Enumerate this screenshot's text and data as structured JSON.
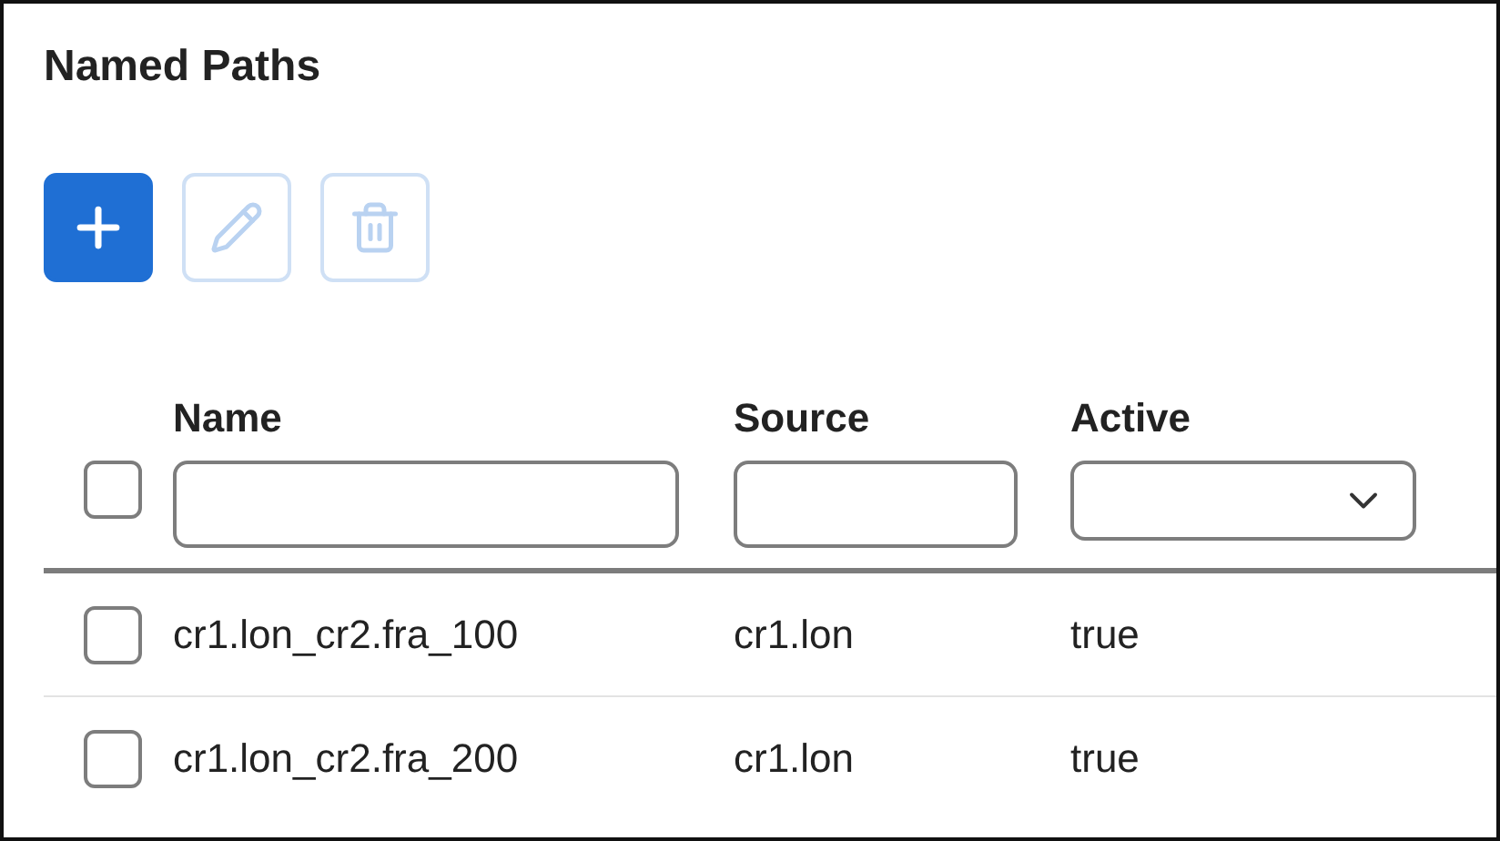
{
  "panel": {
    "title": "Named Paths"
  },
  "toolbar": [
    {
      "kind": "add",
      "disabled": false
    },
    {
      "kind": "edit",
      "disabled": true
    },
    {
      "kind": "delete",
      "disabled": true
    }
  ],
  "table": {
    "select_all": {
      "checked": false
    },
    "columns": [
      {
        "label": "Name",
        "kind": "text"
      },
      {
        "label": "Source",
        "kind": "text"
      },
      {
        "label": "Active",
        "kind": "select"
      }
    ],
    "rows": [
      {
        "checked": false,
        "cells": [
          "cr1.lon_cr2.fra_100",
          "cr1.lon",
          "true"
        ]
      },
      {
        "checked": false,
        "cells": [
          "cr1.lon_cr2.fra_200",
          "cr1.lon",
          "true"
        ]
      }
    ]
  }
}
